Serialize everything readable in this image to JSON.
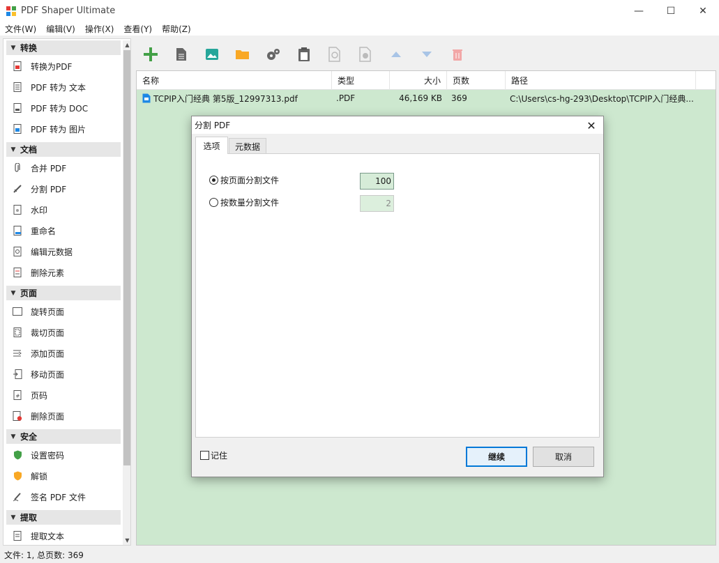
{
  "window": {
    "title": "PDF Shaper Ultimate",
    "minimize": "—",
    "maximize": "☐",
    "close": "✕"
  },
  "menu": [
    "文件(W)",
    "编辑(V)",
    "操作(X)",
    "查看(Y)",
    "帮助(Z)"
  ],
  "sidebar": {
    "groups": [
      {
        "label": "转换",
        "items": [
          {
            "label": "转换为PDF",
            "icon": "pdf-convert-icon"
          },
          {
            "label": "PDF 转为 文本",
            "icon": "text-doc-icon"
          },
          {
            "label": "PDF 转为 DOC",
            "icon": "doc-icon"
          },
          {
            "label": "PDF 转为 图片",
            "icon": "image-icon"
          }
        ]
      },
      {
        "label": "文档",
        "items": [
          {
            "label": "合并 PDF",
            "icon": "paperclip-icon"
          },
          {
            "label": "分割 PDF",
            "icon": "split-icon"
          },
          {
            "label": "水印",
            "icon": "watermark-icon"
          },
          {
            "label": "重命名",
            "icon": "rename-icon"
          },
          {
            "label": "编辑元数据",
            "icon": "metadata-icon"
          },
          {
            "label": "删除元素",
            "icon": "remove-elements-icon"
          }
        ]
      },
      {
        "label": "页面",
        "items": [
          {
            "label": "旋转页面",
            "icon": "rotate-icon"
          },
          {
            "label": "裁切页面",
            "icon": "crop-icon"
          },
          {
            "label": "添加页面",
            "icon": "add-page-icon"
          },
          {
            "label": "移动页面",
            "icon": "move-page-icon"
          },
          {
            "label": "页码",
            "icon": "page-number-icon"
          },
          {
            "label": "删除页面",
            "icon": "delete-page-icon"
          }
        ]
      },
      {
        "label": "安全",
        "items": [
          {
            "label": "设置密码",
            "icon": "shield-icon"
          },
          {
            "label": "解锁",
            "icon": "unlock-icon"
          },
          {
            "label": "签名 PDF 文件",
            "icon": "signature-icon"
          }
        ]
      },
      {
        "label": "提取",
        "items": [
          {
            "label": "提取文本",
            "icon": "extract-text-icon"
          }
        ]
      }
    ]
  },
  "toolbar": [
    "add-icon",
    "document-icon",
    "image-icon",
    "folder-icon",
    "settings-icon",
    "clipboard-icon",
    "find-icon",
    "info-icon",
    "move-up-icon",
    "move-down-icon",
    "trash-icon"
  ],
  "file_list": {
    "columns": [
      "名称",
      "类型",
      "大小",
      "页数",
      "路径"
    ],
    "rows": [
      {
        "name": "TCPIP入门经典  第5版_12997313.pdf",
        "type": ".PDF",
        "size": "46,169 KB",
        "pages": "369",
        "path": "C:\\Users\\cs-hg-293\\Desktop\\TCPIP入门经典..."
      }
    ],
    "background": "#cde8cf"
  },
  "status": {
    "text": "文件: 1, 总页数: 369"
  },
  "dialog": {
    "title": "分割 PDF",
    "tabs": [
      "选项",
      "元数据"
    ],
    "option_by_pages": "按页面分割文件",
    "option_by_pages_value": "100",
    "option_by_count": "按数量分割文件",
    "option_by_count_value": "2",
    "remember_label": "记住",
    "continue_label": "继续",
    "cancel_label": "取消",
    "accent": "#0078d7"
  }
}
